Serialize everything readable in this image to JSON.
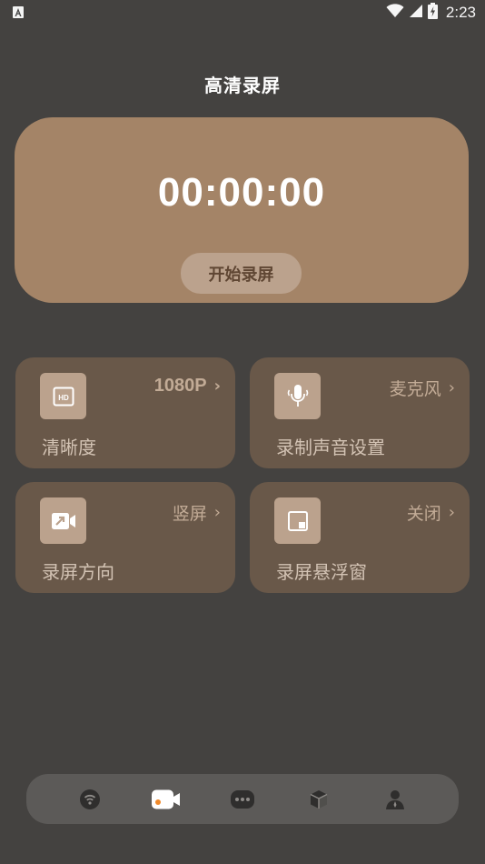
{
  "status_bar": {
    "time": "2:23",
    "left_icon": "a-notification-icon",
    "icons": [
      "wifi-icon",
      "signal-icon",
      "battery-charging-icon"
    ]
  },
  "header": {
    "title": "高清录屏"
  },
  "timer_card": {
    "timer": "00:00:00",
    "start_label": "开始录屏"
  },
  "settings": {
    "resolution": {
      "value": "1080P",
      "label": "清晰度",
      "icon": "hd-icon"
    },
    "audio": {
      "value": "麦克风",
      "label": "录制声音设置",
      "icon": "microphone-icon"
    },
    "orientation": {
      "value": "竖屏",
      "label": "录屏方向",
      "icon": "video-camera-icon"
    },
    "floating": {
      "value": "关闭",
      "label": "录屏悬浮窗",
      "icon": "floating-window-icon"
    }
  },
  "bottom_nav": {
    "items": [
      "cast-icon",
      "record-camera-icon",
      "game-icon",
      "box-icon",
      "profile-icon"
    ],
    "active": "record-camera-icon"
  },
  "colors": {
    "background": "#444240",
    "card_accent": "#a48467",
    "card": "#695849",
    "icon_box": "#bba28d",
    "active_dot": "#f08a2b"
  }
}
